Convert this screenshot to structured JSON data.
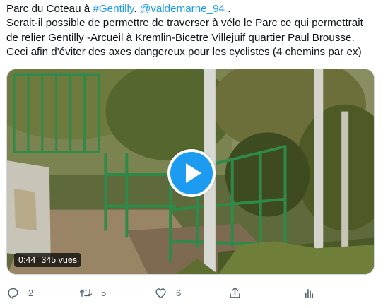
{
  "tweet": {
    "line1": {
      "prefix": "Parc du Coteau à ",
      "hashtag": "#Gentilly",
      "between": ". ",
      "mention": "@valdemarne_94",
      "suffix": " ."
    },
    "line2": "Serait-il possible de permettre de traverser à vélo le Parc ce qui permettrait",
    "line3": "de relier Gentilly -Arcueil à Kremlin-Bicetre Villejuif quartier Paul Brousse.",
    "line4": "Ceci afin d'éviter des axes dangereux pour les cyclistes (4 chemins par ex)"
  },
  "video": {
    "duration": "0:44",
    "views": "345 vues",
    "play_icon": "play-icon"
  },
  "actions": {
    "reply": {
      "icon": "reply-icon",
      "count": "2"
    },
    "retweet": {
      "icon": "retweet-icon",
      "count": "5"
    },
    "like": {
      "icon": "heart-icon",
      "count": "6"
    },
    "share": {
      "icon": "share-icon"
    },
    "analytics": {
      "icon": "analytics-icon"
    }
  },
  "colors": {
    "accent": "#1d9bf0",
    "text": "#0f1419",
    "muted": "#536471"
  }
}
